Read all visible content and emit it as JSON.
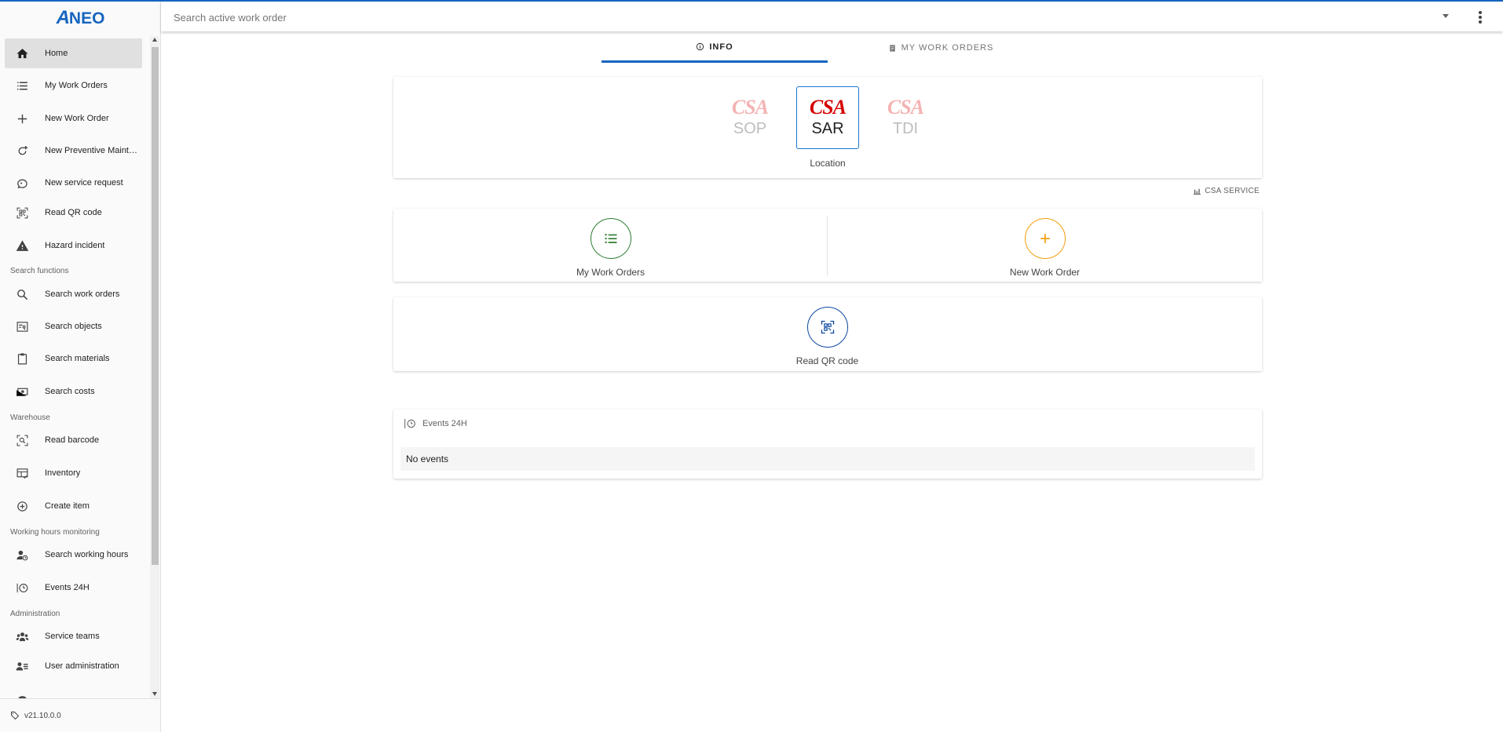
{
  "app": {
    "logo": "ANEO",
    "version": "v21.10.0.0"
  },
  "search": {
    "placeholder": "Search active work order"
  },
  "sidebar": {
    "items": [
      {
        "label": "Home"
      },
      {
        "label": "My Work Orders"
      },
      {
        "label": "New Work Order"
      },
      {
        "label": "New Preventive Maintenance"
      },
      {
        "label": "New service request"
      },
      {
        "label": "Read QR code"
      },
      {
        "label": "Hazard incident"
      },
      {
        "label": "Search work orders"
      },
      {
        "label": "Search objects"
      },
      {
        "label": "Search materials"
      },
      {
        "label": "Search costs"
      },
      {
        "label": "Read barcode"
      },
      {
        "label": "Inventory"
      },
      {
        "label": "Create item"
      },
      {
        "label": "Search working hours"
      },
      {
        "label": "Events 24H"
      },
      {
        "label": "Service teams"
      },
      {
        "label": "User administration"
      }
    ],
    "sections": [
      "Search functions",
      "Warehouse",
      "Working hours monitoring",
      "Administration"
    ]
  },
  "tabs": [
    {
      "label": "INFO",
      "active": true
    },
    {
      "label": "MY WORK ORDERS",
      "active": false
    }
  ],
  "locations": {
    "brand": "CSA",
    "items": [
      {
        "name": "SOP",
        "selected": false
      },
      {
        "name": "SAR",
        "selected": true
      },
      {
        "name": "TDI",
        "selected": false
      }
    ],
    "label": "Location"
  },
  "service": {
    "label": "CSA SERVICE"
  },
  "actions": {
    "my_work_orders": "My Work Orders",
    "new_work_order": "New Work Order",
    "read_qr": "Read QR code"
  },
  "events": {
    "title": "Events 24H",
    "empty": "No events"
  },
  "colors": {
    "accent": "#1565c0",
    "green": "#2e7d32",
    "orange": "#f59e0b",
    "brand_red": "#d50000"
  }
}
